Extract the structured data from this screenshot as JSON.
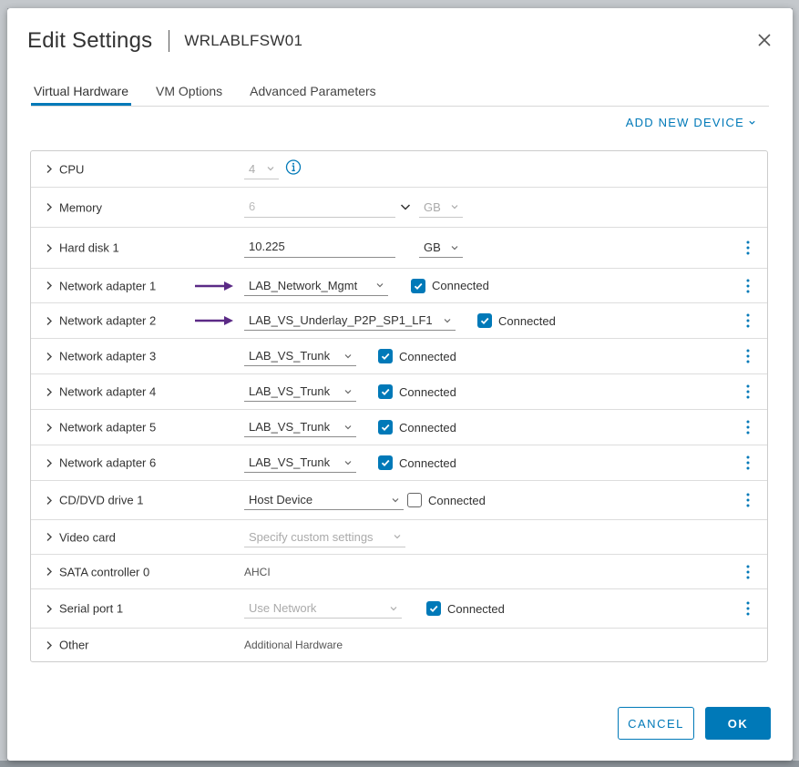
{
  "dialog": {
    "title": "Edit Settings",
    "vm_name": "WRLABLFSW01"
  },
  "tabs": [
    {
      "label": "Virtual Hardware",
      "active": true
    },
    {
      "label": "VM Options",
      "active": false
    },
    {
      "label": "Advanced Parameters",
      "active": false
    }
  ],
  "add_device_label": "ADD NEW DEVICE",
  "hardware": {
    "cpu": {
      "label": "CPU",
      "value": "4"
    },
    "memory": {
      "label": "Memory",
      "value": "6",
      "unit": "GB"
    },
    "hard_disk_1": {
      "label": "Hard disk 1",
      "value": "10.225",
      "unit": "GB"
    },
    "network_adapters": [
      {
        "label": "Network adapter 1",
        "network": "LAB_Network_Mgmt",
        "connected_label": "Connected",
        "connected": true
      },
      {
        "label": "Network adapter 2",
        "network": "LAB_VS_Underlay_P2P_SP1_LF1",
        "connected_label": "Connected",
        "connected": true
      },
      {
        "label": "Network adapter 3",
        "network": "LAB_VS_Trunk",
        "connected_label": "Connected",
        "connected": true
      },
      {
        "label": "Network adapter 4",
        "network": "LAB_VS_Trunk",
        "connected_label": "Connected",
        "connected": true
      },
      {
        "label": "Network adapter 5",
        "network": "LAB_VS_Trunk",
        "connected_label": "Connected",
        "connected": true
      },
      {
        "label": "Network adapter 6",
        "network": "LAB_VS_Trunk",
        "connected_label": "Connected",
        "connected": true
      }
    ],
    "cd_dvd": {
      "label": "CD/DVD drive 1",
      "value": "Host Device",
      "connected_label": "Connected",
      "connected": false
    },
    "video_card": {
      "label": "Video card",
      "value": "Specify custom settings"
    },
    "sata": {
      "label": "SATA controller 0",
      "value": "AHCI"
    },
    "serial_port": {
      "label": "Serial port 1",
      "value": "Use Network",
      "connected_label": "Connected",
      "connected": true
    },
    "other": {
      "label": "Other",
      "value": "Additional Hardware"
    }
  },
  "buttons": {
    "cancel": "CANCEL",
    "ok": "OK"
  },
  "colors": {
    "accent": "#0079b8",
    "annotation_arrow": "#5b2a86"
  }
}
